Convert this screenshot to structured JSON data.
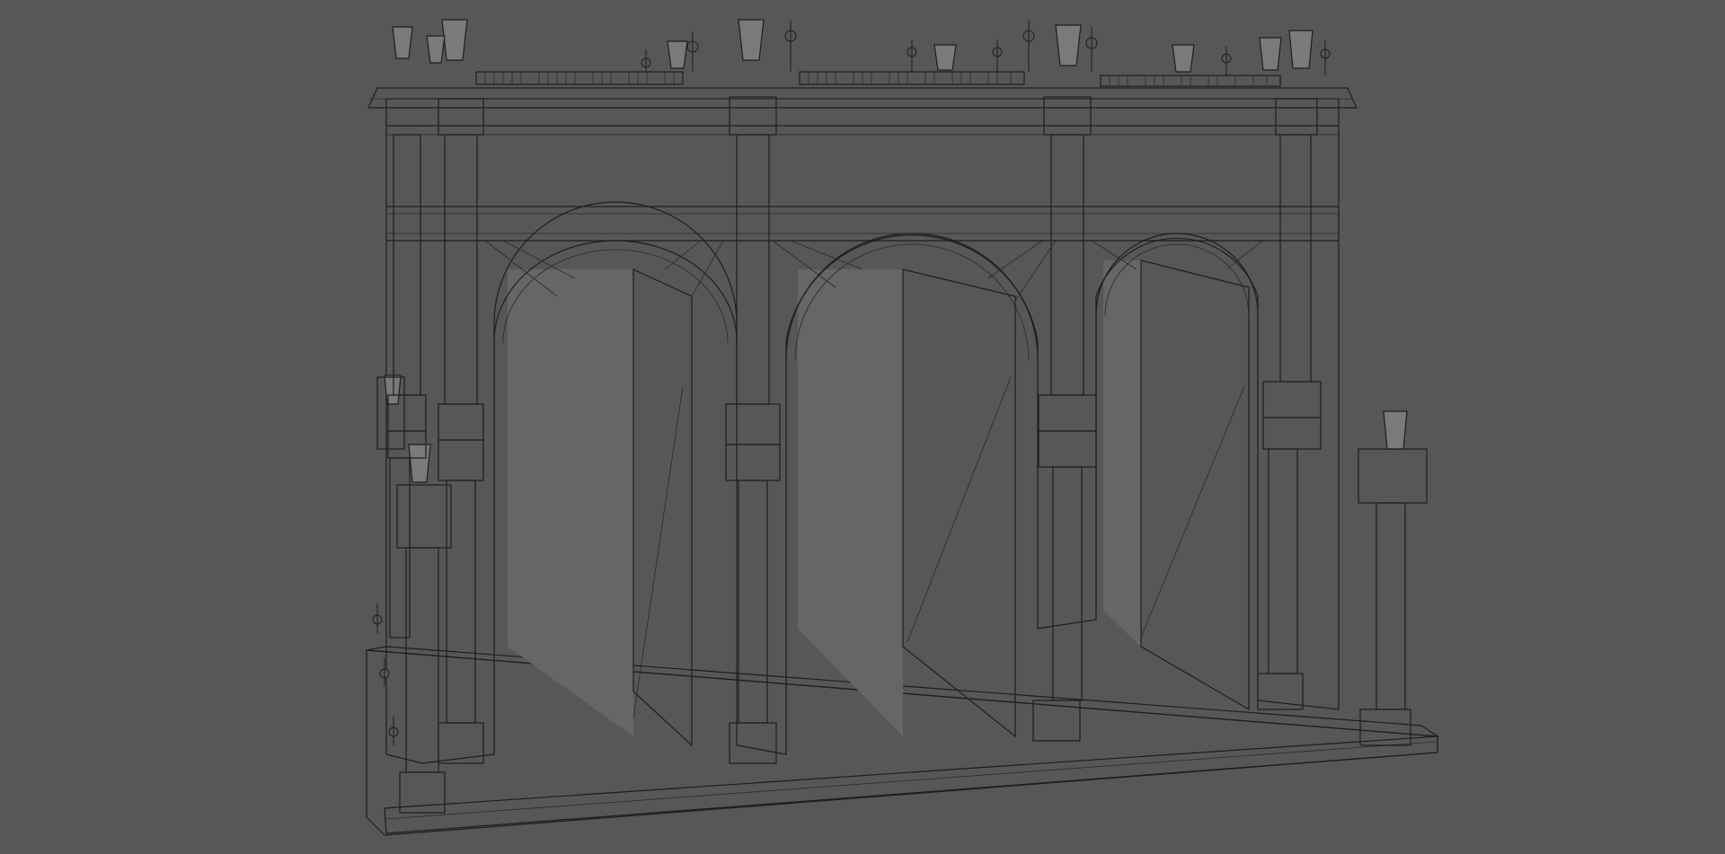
{
  "viewport": {
    "mode": "3d-wireframe-shaded",
    "background_color": "#575757",
    "model_color": "#8e8e8e",
    "wire_color": "#1e1e1e"
  },
  "model": {
    "subject": "triple-arch-colonnade",
    "arch_count": 3,
    "column_style": "fluted-column"
  }
}
